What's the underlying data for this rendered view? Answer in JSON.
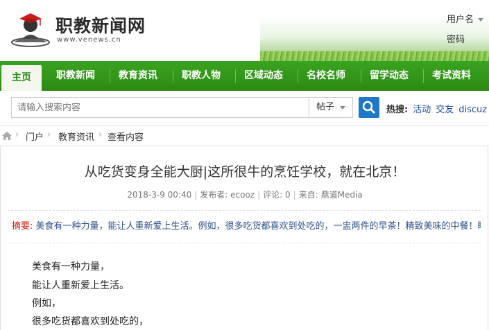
{
  "header": {
    "site_title": "职教新闻网",
    "site_url": "www.venews.cn",
    "username_label": "用户名",
    "password_label": "密码"
  },
  "nav": {
    "items": [
      "主页",
      "职教新闻",
      "教育资讯",
      "职教人物",
      "区域动态",
      "名校名师",
      "留学动态",
      "考试资料"
    ],
    "active_index": 0
  },
  "search": {
    "placeholder": "请输入搜索内容",
    "type_selected": "帖子",
    "hot_label": "热搜:",
    "hot_links": [
      "活动",
      "交友",
      "discuz"
    ]
  },
  "breadcrumb": [
    "门户",
    "教育资讯",
    "查看内容"
  ],
  "article": {
    "title": "从吃货变身全能大厨|这所很牛的烹饪学校，就在北京！",
    "date": "2018-3-9 00:40",
    "author_label": "发布者:",
    "author": "ecooz",
    "comments_label": "评论:",
    "comments": "0",
    "source_label": "来自:",
    "source": "鼎道Media",
    "summary_label": "摘要:",
    "summary": "美食有一种力量，能让人重新爱上生活。例如，很多吃货都喜欢到处吃的，一盅两件的早茶！精致美味的中餐！睡",
    "body_lines": [
      "美食有一种力量，",
      "能让人重新爱上生活。",
      "例如，",
      "很多吃货都喜欢到处吃的，"
    ]
  },
  "colors": {
    "nav_green": "#3aa320",
    "search_blue": "#1f77c7",
    "summary_red": "#d0201a"
  }
}
